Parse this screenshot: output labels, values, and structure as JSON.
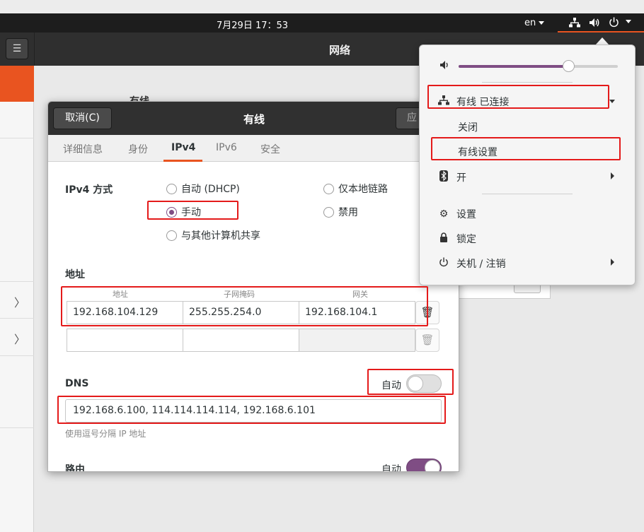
{
  "topbar": {
    "clock": "7月29日 17：53",
    "language": "en"
  },
  "settings_window": {
    "title": "网络",
    "background_section": "有线"
  },
  "dialog": {
    "cancel_label": "取消(C)",
    "title": "有线",
    "apply_label": "应",
    "tabs": [
      {
        "label": "详细信息",
        "active": false
      },
      {
        "label": "身份",
        "active": false
      },
      {
        "label": "IPv4",
        "active": true
      },
      {
        "label": "IPv6",
        "active": false
      },
      {
        "label": "安全",
        "active": false
      }
    ],
    "ipv4_method_label": "IPv4 方式",
    "methods": {
      "auto_dhcp": "自动 (DHCP)",
      "link_local": "仅本地链路",
      "manual": "手动",
      "disable": "禁用",
      "shared": "与其他计算机共享"
    },
    "selected_method": "manual",
    "address_section": "地址",
    "address_columns": [
      "地址",
      "子网掩码",
      "网关"
    ],
    "address_rows": [
      [
        "192.168.104.129",
        "255.255.254.0",
        "192.168.104.1"
      ],
      [
        "",
        "",
        ""
      ]
    ],
    "dns": {
      "label": "DNS",
      "auto_label": "自动",
      "auto_on": false,
      "value": "192.168.6.100, 114.114.114.114, 192.168.6.101",
      "hint": "使用逗号分隔 IP 地址"
    },
    "routes": {
      "label": "路由",
      "auto_label": "自动",
      "auto_on": true
    }
  },
  "system_menu": {
    "volume_level": 0.69,
    "wired_status": "有线 已连接",
    "wired_off": "关闭",
    "wired_settings": "有线设置",
    "bluetooth": "开",
    "settings": "设置",
    "lock": "锁定",
    "power": "关机 / 注销"
  },
  "colors": {
    "accent": "#e95420",
    "toggle_on": "#7f4d84",
    "annotation": "#e41a1a"
  }
}
